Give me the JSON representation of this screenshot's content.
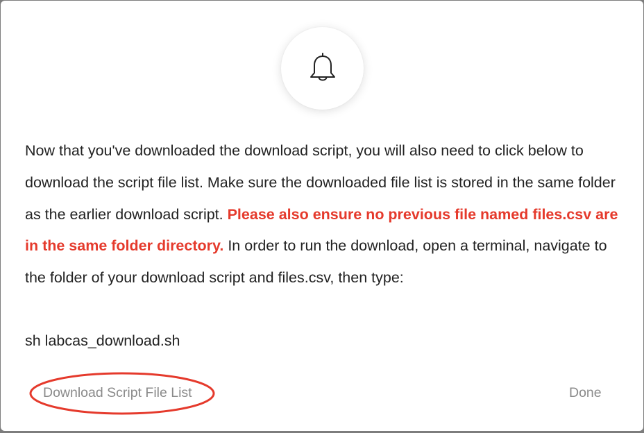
{
  "dialog": {
    "icon": "bell-icon",
    "message": {
      "text_before": "Now that you've downloaded the download script, you will also need to click below to download the script file list. Make sure the downloaded file list is stored in the same folder as the earlier download script. ",
      "warning": "Please also ensure no previous file named files.csv are in the same folder directory.",
      "text_after": " In order to run the download, open a terminal, navigate to the folder of your download script and files.csv, then type:"
    },
    "command": "sh labcas_download.sh",
    "buttons": {
      "download_label": "Download Script File List",
      "done_label": "Done"
    },
    "colors": {
      "warning": "#e53a2c",
      "annotation": "#e53a2c",
      "button_text": "#8a8a8a"
    }
  }
}
